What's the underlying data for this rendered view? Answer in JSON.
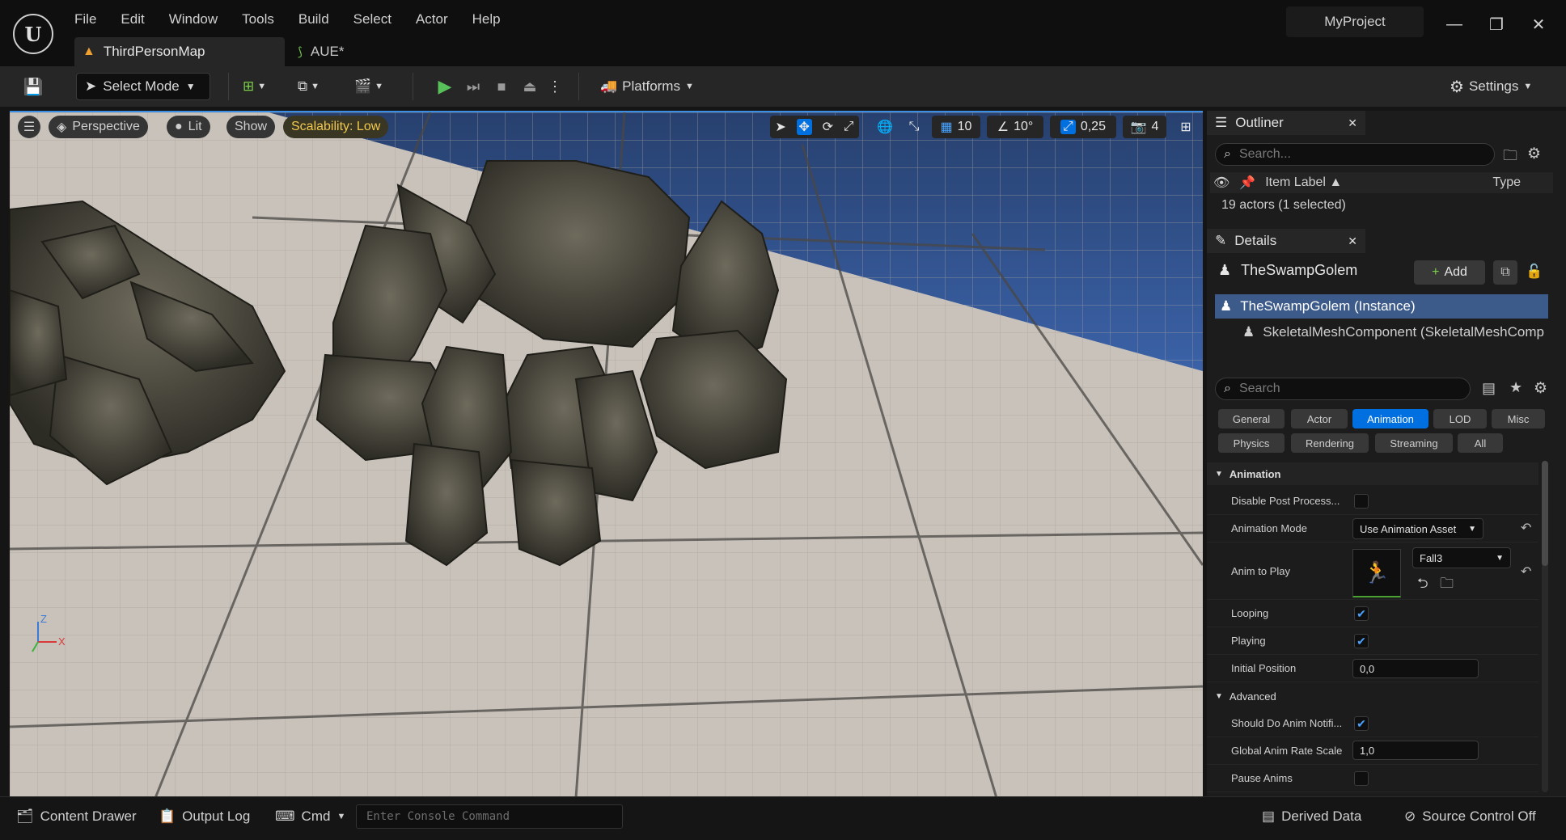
{
  "menu": [
    "File",
    "Edit",
    "Window",
    "Tools",
    "Build",
    "Select",
    "Actor",
    "Help"
  ],
  "tabs": {
    "map": "ThirdPersonMap",
    "blueprint": "AUE*"
  },
  "project_name": "MyProject",
  "toolbar": {
    "select_mode": "Select Mode",
    "platforms": "Platforms",
    "settings": "Settings"
  },
  "viewport": {
    "perspective": "Perspective",
    "lit": "Lit",
    "show": "Show",
    "scalability": "Scalability: Low",
    "grid_snap": "10",
    "rotation_snap": "10°",
    "scale_snap": "0,25",
    "camera_speed": "4",
    "axis_z": "Z",
    "axis_x": "X"
  },
  "outliner": {
    "title": "Outliner",
    "search_placeholder": "Search...",
    "col_label": "Item Label",
    "col_type": "Type",
    "summary": "19 actors (1 selected)"
  },
  "details": {
    "title": "Details",
    "actor_name": "TheSwampGolem",
    "add_label": "Add",
    "instance": "TheSwampGolem (Instance)",
    "component": "SkeletalMeshComponent (SkeletalMeshComp",
    "search_placeholder": "Search",
    "categories": [
      "General",
      "Actor",
      "Animation",
      "LOD",
      "Misc",
      "Physics",
      "Rendering",
      "Streaming",
      "All"
    ],
    "section_animation": "Animation",
    "section_advanced": "Advanced",
    "props": {
      "disable_post": "Disable Post Process...",
      "anim_mode": "Animation Mode",
      "anim_mode_value": "Use Animation Asset",
      "anim_to_play": "Anim to Play",
      "anim_asset": "Fall3",
      "looping": "Looping",
      "playing": "Playing",
      "initial_position": "Initial Position",
      "initial_position_value": "0,0",
      "should_do_notify": "Should Do Anim Notifi...",
      "global_rate": "Global Anim Rate Scale",
      "global_rate_value": "1,0",
      "pause_anims": "Pause Anims"
    }
  },
  "statusbar": {
    "content_drawer": "Content Drawer",
    "output_log": "Output Log",
    "cmd": "Cmd",
    "console_placeholder": "Enter Console Command",
    "derived_data": "Derived Data",
    "source_control": "Source Control Off"
  }
}
